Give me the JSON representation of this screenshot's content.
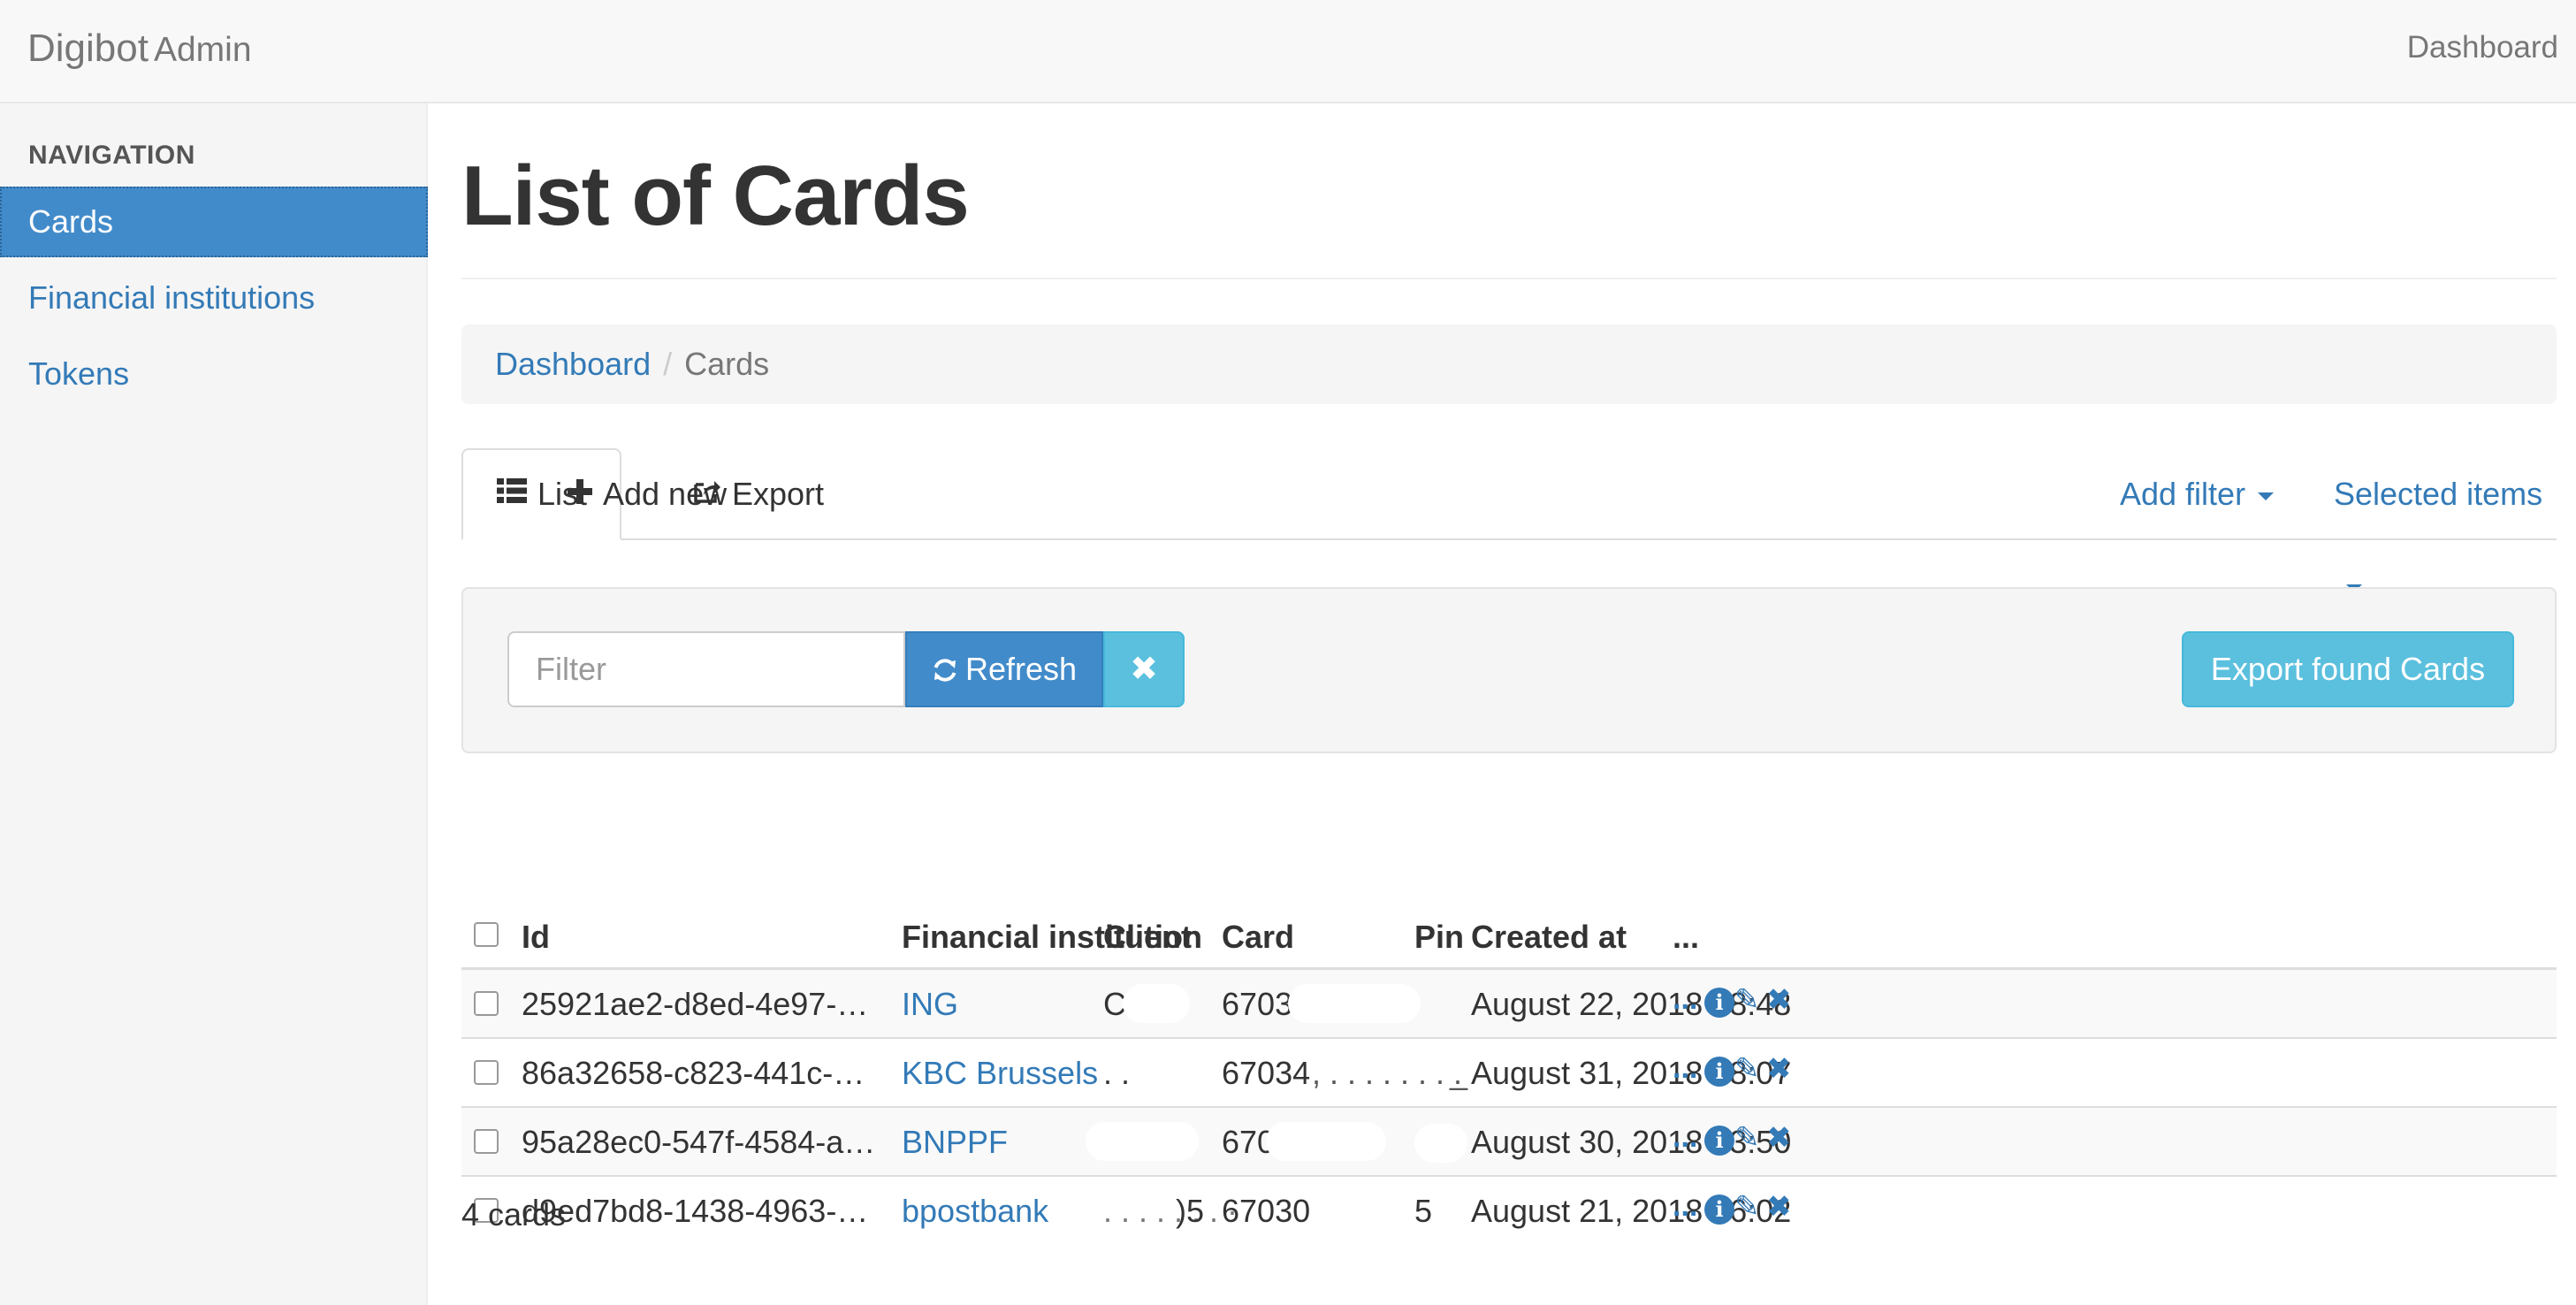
{
  "navbar": {
    "brand_main": "Digibot",
    "brand_sub": "Admin",
    "right_link": "Dashboard"
  },
  "sidebar": {
    "header": "NAVIGATION",
    "items": [
      {
        "label": "Cards",
        "active": true
      },
      {
        "label": "Financial institutions",
        "active": false
      },
      {
        "label": "Tokens",
        "active": false
      }
    ]
  },
  "page": {
    "title": "List of Cards"
  },
  "breadcrumb": {
    "home": "Dashboard",
    "current": "Cards"
  },
  "tabs": {
    "list": "List",
    "add_new": "Add new",
    "export": "Export",
    "add_filter": "Add filter",
    "selected_items": "Selected items"
  },
  "filter": {
    "placeholder": "Filter",
    "value": "",
    "refresh_label": "Refresh",
    "clear_symbol": "✖",
    "export_found_label": "Export found Cards"
  },
  "table": {
    "columns": [
      "Id",
      "Financial institution",
      "Client",
      "Card",
      "Pin",
      "Created at",
      "..."
    ],
    "rows": [
      {
        "id": "25921ae2-d8ed-4e97-…",
        "fi": "ING",
        "client": "C",
        "card": "6703",
        "pin": "",
        "created": "August 22, 2018 08:48"
      },
      {
        "id": "86a32658-c823-441c-…",
        "fi": "KBC Brussels",
        "client": "",
        "card": "67034",
        "pin": "",
        "created": "August 31, 2018 08:07"
      },
      {
        "id": "95a28ec0-547f-4584-a…",
        "fi": "BNPPF",
        "client": "",
        "card": "67030",
        "pin": "",
        "created": "August 30, 2018 13:50"
      },
      {
        "id": "d9ed7bd8-1438-4963-…",
        "fi": "bpostbank",
        "client": "5",
        "card": "67030",
        "pin": "",
        "created": "August 21, 2018 16:02"
      }
    ],
    "row_actions": {
      "more": "...",
      "info": "i",
      "edit": "✎",
      "delete": "✖"
    }
  },
  "footer": {
    "count_text": "4 cards"
  },
  "colors": {
    "link": "#337ab7",
    "primary": "#428bca",
    "info": "#5bc0de"
  }
}
